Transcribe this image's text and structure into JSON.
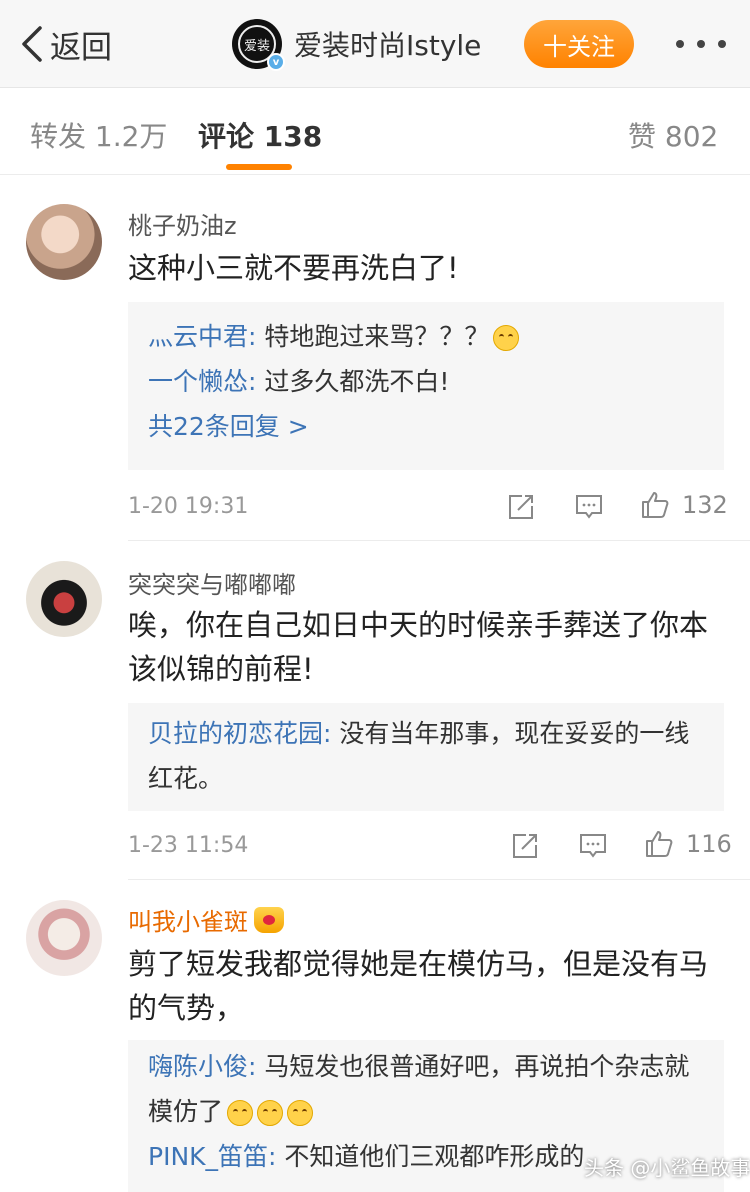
{
  "topbar": {
    "back_label": "返回",
    "account_name": "爱装时尚Istyle",
    "brand_badge": "爱装",
    "follow_label": "十关注",
    "accent_color": "#ff8200"
  },
  "tabs": [
    {
      "label": "转发 1.2万",
      "active": false
    },
    {
      "label": "评论 138",
      "active": true
    },
    {
      "label": "赞 802",
      "active": false
    }
  ],
  "comments": [
    {
      "user": "桃子奶油z",
      "text": "这种小三就不要再洗白了!",
      "replies": [
        {
          "user": "灬云中君:",
          "text": " 特地跑过来骂？？？"
        },
        {
          "user": "一个懒怂:",
          "text": " 过多久都洗不白!"
        }
      ],
      "more_replies": "共22条回复 >",
      "time": "1-20 19:31",
      "likes": "132"
    },
    {
      "user": "突突突与嘟嘟嘟",
      "text": "唉，你在自己如日中天的时候亲手葬送了你本该似锦的前程!",
      "replies": [
        {
          "user": "贝拉的初恋花园:",
          "text": " 没有当年那事，现在妥妥的一线红花。"
        }
      ],
      "time": "1-23 11:54",
      "likes": "116"
    },
    {
      "user": "叫我小雀斑",
      "text": "剪了短发我都觉得她是在模仿马，但是没有马的气势，",
      "replies": [
        {
          "user": "嗨陈小俊:",
          "text": " 马短发也很普通好吧，再说拍个杂志就模仿了"
        },
        {
          "user": "PINK_笛笛:",
          "text": " 不知道他们三观都咋形成的"
        }
      ]
    }
  ],
  "watermark": "头条 @小鲨鱼故事",
  "icons": [
    "back-arrow-icon",
    "more-dots-icon",
    "repost-icon",
    "comment-icon",
    "like-icon",
    "crown-badge-icon",
    "emoji-icon"
  ]
}
